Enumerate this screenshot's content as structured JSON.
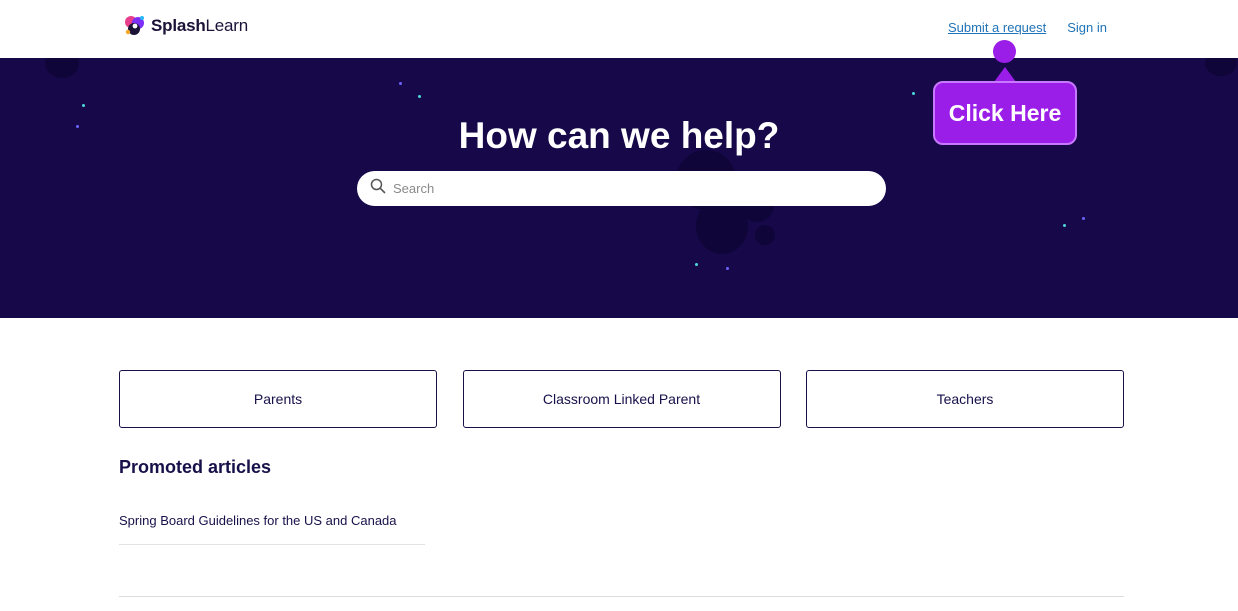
{
  "header": {
    "logo_bold": "Splash",
    "logo_light": "Learn",
    "nav": {
      "submit_request": "Submit a request",
      "sign_in": "Sign in"
    }
  },
  "hero": {
    "title": "How can we help?",
    "search_placeholder": "Search"
  },
  "callout": {
    "label": "Click Here",
    "color": "#9b1ee8"
  },
  "categories": [
    {
      "label": "Parents"
    },
    {
      "label": "Classroom Linked Parent"
    },
    {
      "label": "Teachers"
    }
  ],
  "promoted": {
    "title": "Promoted articles",
    "articles": [
      {
        "title": "Spring Board Guidelines for the US and Canada"
      }
    ]
  },
  "colors": {
    "hero_bg": "#17084a",
    "link": "#1f73b7",
    "text": "#17114a"
  }
}
